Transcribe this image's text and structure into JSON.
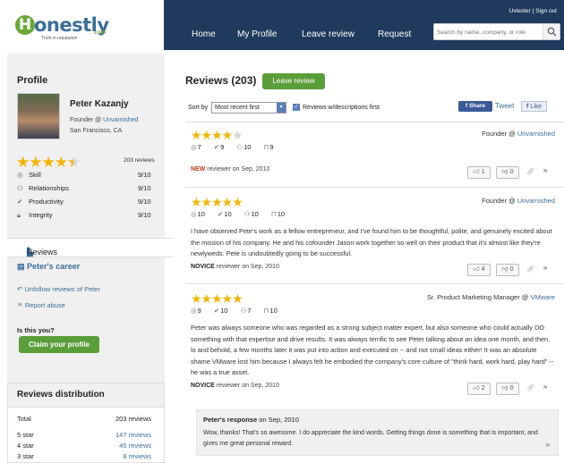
{
  "header": {
    "logo_letter": "H",
    "logo_rest": "onestly",
    "logo_domain": ".com",
    "logo_tagline": "Truth in reputation",
    "user_name": "Uvtester",
    "sign_out": "Sign out",
    "nav": [
      "Home",
      "My Profile",
      "Leave review",
      "Request"
    ],
    "search_placeholder": "Search by name, company, or role"
  },
  "sidebar": {
    "title": "Profile",
    "name": "Peter Kazanjy",
    "role": "Founder @",
    "company": "Unvarnished",
    "location": "San Francisco, CA",
    "rating_stars": 4.5,
    "review_count": "203 reviews",
    "metrics": [
      {
        "label": "Skill",
        "value": "9/10",
        "icon": "target-icon"
      },
      {
        "label": "Relationships",
        "value": "9/10",
        "icon": "people-icon"
      },
      {
        "label": "Productivity",
        "value": "9/10",
        "icon": "check-icon"
      },
      {
        "label": "Integrity",
        "value": "9/10",
        "icon": "lock-icon"
      }
    ],
    "tab_reviews": "Reviews",
    "tab_career": "Peter's career",
    "unfollow": "Unfollow reviews of Peter",
    "report": "Report abuse",
    "is_this_you": "Is this you?",
    "claim": "Claim your profile"
  },
  "distribution": {
    "title": "Reviews distribution",
    "rows": [
      {
        "label": "Total",
        "value": "203 reviews"
      },
      {
        "label": "5 star",
        "value": "147 reviews"
      },
      {
        "label": "4 star",
        "value": "45 reviews"
      },
      {
        "label": "3 star",
        "value": "8 reviews"
      }
    ]
  },
  "main": {
    "title": "Reviews (203)",
    "leave_review": "Leave review",
    "sort_label": "Sort by",
    "sort_value": "Most recent first",
    "desc_first": "Reviews w/descriptions first",
    "share": "Share",
    "tweet": "Tweet",
    "like": "Like",
    "reviews": [
      {
        "stars": 4,
        "skill": "7",
        "productivity": "9",
        "relationships": "10",
        "integrity": "9",
        "role": "Founder @",
        "company": "Unvarnished",
        "body": "",
        "new_tag": "NEW",
        "reviewer": "reviewer on Sep, 2010",
        "up": "1",
        "down": "0"
      },
      {
        "stars": 5,
        "skill": "10",
        "productivity": "10",
        "relationships": "10",
        "integrity": "10",
        "role": "Founder @",
        "company": "Unvarnished",
        "body": "I have observed Pete's work as a fellow entrepreneur, and I've found him to be thoughtful, polite, and genuinely excited about the mission of his company. He and his cofounder Jason work together so well on their product that it's almost like they're newlyweds. Pete is undoubtedly going to be successful.",
        "new_tag": "NOVICE",
        "reviewer": "reviewer on Sep, 2010",
        "up": "4",
        "down": "0"
      },
      {
        "stars": 5,
        "skill": "9",
        "productivity": "10",
        "relationships": "7",
        "integrity": "10",
        "role": "Sr. Product Marketing Manager @",
        "company": "VMware",
        "body": "Peter was always someone who was regarded as a strong subject matter expert, but also someone who could actually DO something with that expertise and drive results. It was always terrific to see Peter talking about an idea one month, and then, lo and behold, a few months later it was put into action and executed on -- and not small ideas either! It was an absolute shame VMware lost him because I always felt he embodied the company's core culture of \"think hard, work hard, play hard\" -- he was a true asset.",
        "new_tag": "NOVICE",
        "reviewer": "reviewer on Sep, 2010",
        "up": "2",
        "down": "0"
      }
    ],
    "response": {
      "author": "Peter's response",
      "date": "on Sep, 2010",
      "body": "Wow, thanks! That's so awesome. I do appreciate the kind words. Getting things done is something that is important, and gives me great personal reward."
    }
  }
}
